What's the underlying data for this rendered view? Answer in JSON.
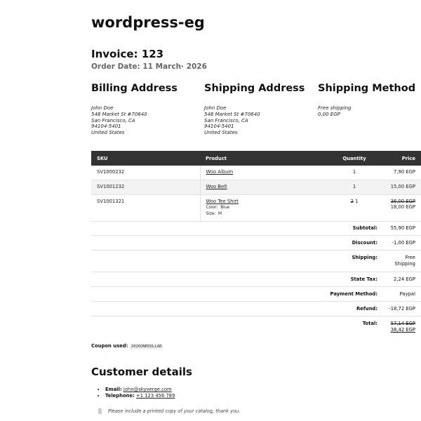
{
  "site": {
    "title": "wordpress-eg"
  },
  "invoice": {
    "title": "Invoice: 123",
    "order_date": "Order Date: 11 March· 2026"
  },
  "billing": {
    "heading": "Billing Address",
    "lines": [
      "John Doe",
      "548 Market St #70640",
      "San Francisco, CA",
      "94104-5401",
      "United States"
    ]
  },
  "shipping": {
    "heading": "Shipping Address",
    "lines": [
      "John Doe",
      "548 Market St #70640",
      "San Francisco, CA",
      "94104-5401",
      "United States"
    ]
  },
  "method": {
    "heading": "Shipping Method",
    "lines": [
      "Free shipping",
      "0,00 EGP"
    ]
  },
  "items_table": {
    "headers": {
      "sku": "SKU",
      "product": "Product",
      "quantity": "Quantity",
      "price": "Price"
    },
    "rows": [
      {
        "sku": "SV1000232",
        "product": "Woo Album",
        "qty": "1",
        "price": "7,90 EGP"
      },
      {
        "sku": "SV1001232",
        "product": "Woo Belt",
        "qty": "1",
        "price": "15,00 EGP"
      },
      {
        "sku": "SV1001321",
        "product": "Woo Tee Shirt",
        "color_label": "Color:",
        "color_value": "Blue",
        "size_label": "Size:",
        "size_value": "M",
        "qty_old": "2",
        "qty": "1",
        "price_old": "36,00 EGP",
        "price": "18,00 EGP"
      }
    ]
  },
  "totals": {
    "subtotal": {
      "label": "Subtotal:",
      "value": "55,90 EGP"
    },
    "discount": {
      "label": "Discount:",
      "value": "-1,00 EGP"
    },
    "shipping": {
      "label": "Shipping:",
      "value_line1": "Free",
      "value_line2": "Shipping"
    },
    "state_tax": {
      "label": "State Tax:",
      "value": "2,24 EGP"
    },
    "payment_method": {
      "label": "Payment Method:",
      "value": "Paypal"
    },
    "refund": {
      "label": "Refund:",
      "value": "-18,72 EGP"
    },
    "total": {
      "label": "Total:",
      "value_old": "57,14 EGP",
      "value": "38,42 EGP"
    }
  },
  "coupon": {
    "label": "Coupon used:",
    "code": "2026ONEDOLLAR"
  },
  "customer": {
    "heading": "Customer details",
    "email_label": "Email:",
    "email": "john@skyverge.com",
    "phone_label": "Telephone:",
    "phone": "+1 123 456 789",
    "note": "Please include a printed copy of your catalog, thank you."
  }
}
